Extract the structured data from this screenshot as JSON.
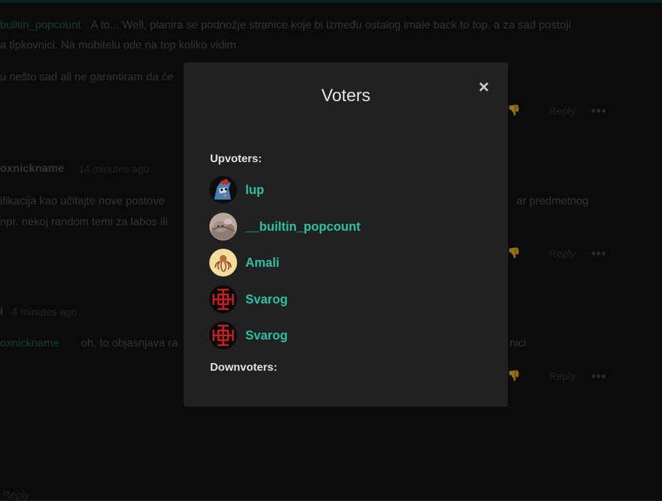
{
  "background": {
    "comment1": {
      "mention": "builtin_popcount",
      "line1": "A to... Well, planira se podnožje stranice koje bi između ostalog imale back to top, a za sad postoji",
      "line2": "a tipkovnici. Na mobitelu ode na top koliko vidim",
      "line3": "u nešto sad ali ne garantiram da će",
      "reply": "Reply"
    },
    "comment2": {
      "author": "oxnickname",
      "time": "14 minutes ago",
      "line1": "ifikacija kao učitajte nove postove",
      "line1_right": "ar predmetnog",
      "line2": "npr. nekoj random temi za labos ili",
      "reply": "Reply"
    },
    "comment3": {
      "author": "i",
      "time": "4 minutes ago",
      "mention": "oxnickname",
      "text": "oh, to objasnjava ra",
      "text_right": "nici",
      "reply": "Reply"
    },
    "footer_reply": "Reply",
    "more_glyph": "•••",
    "thumb_glyph": "👎"
  },
  "modal": {
    "title": "Voters",
    "close_glyph": "×",
    "upvoters_label": "Upvoters:",
    "downvoters_label": "Downvoters:",
    "upvoters": [
      {
        "name": "lup",
        "avatar": "fox-mascot-icon"
      },
      {
        "name": "__builtin_popcount",
        "avatar": "cat-photo-icon"
      },
      {
        "name": "Amali",
        "avatar": "octopus-drawing-icon"
      },
      {
        "name": "Svarog",
        "avatar": "svarog-symbol-icon"
      },
      {
        "name": "Svarog",
        "avatar": "svarog-symbol-icon"
      }
    ],
    "name_color": "#27c2a2"
  }
}
